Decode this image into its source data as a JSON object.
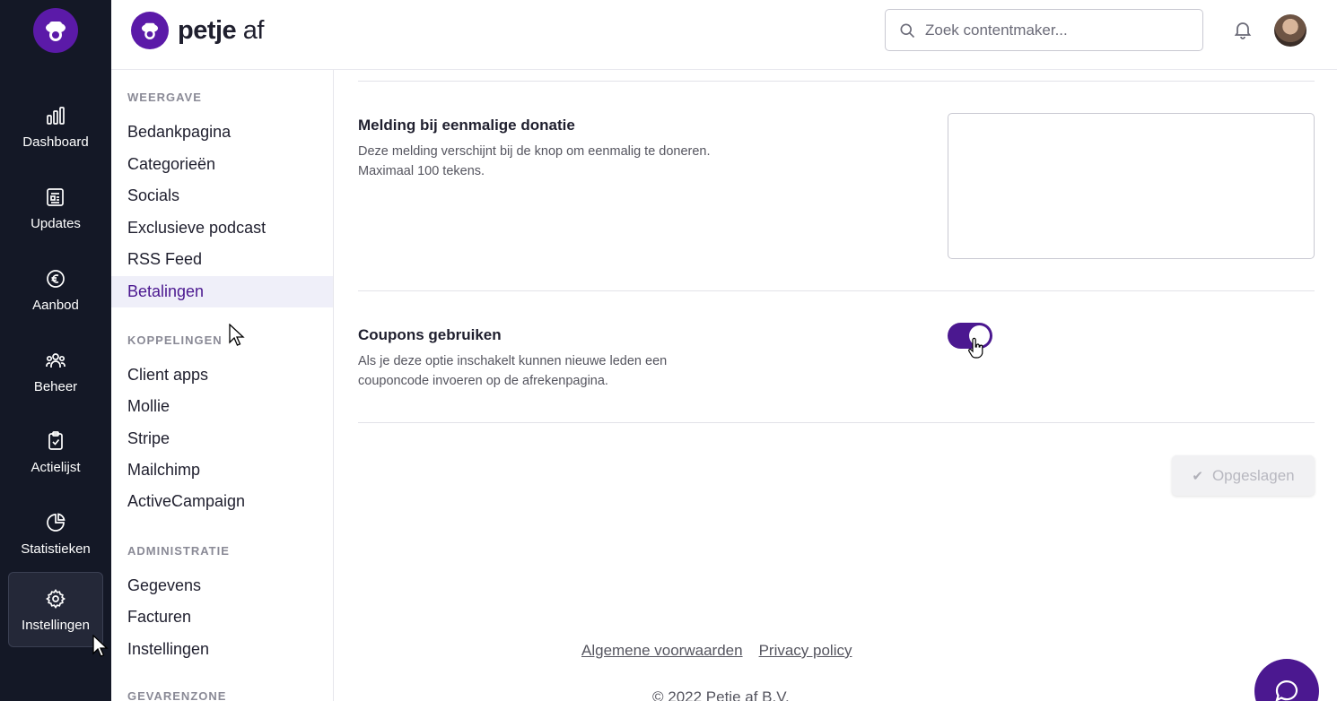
{
  "brand": {
    "name_bold": "petje",
    "name_thin": " af"
  },
  "header": {
    "search": {
      "placeholder": "Zoek contentmaker..."
    },
    "icons": {
      "notifications": "bell-icon",
      "profile": "avatar"
    }
  },
  "rail": {
    "items": [
      {
        "label": "Dashboard",
        "icon": "bar-chart-icon"
      },
      {
        "label": "Updates",
        "icon": "newspaper-icon"
      },
      {
        "label": "Aanbod",
        "icon": "euro-icon"
      },
      {
        "label": "Beheer",
        "icon": "users-icon"
      },
      {
        "label": "Actielijst",
        "icon": "clipboard-check-icon"
      },
      {
        "label": "Statistieken",
        "icon": "pie-chart-icon"
      },
      {
        "label": "Instellingen",
        "icon": "gear-icon",
        "active": true
      }
    ]
  },
  "subnav": {
    "sections": [
      {
        "title": "WEERGAVE",
        "items": [
          "Bedankpagina",
          "Categorieën",
          "Socials",
          "Exclusieve podcast",
          "RSS Feed",
          "Betalingen"
        ]
      },
      {
        "title": "KOPPELINGEN",
        "items": [
          "Client apps",
          "Mollie",
          "Stripe",
          "Mailchimp",
          "ActiveCampaign"
        ]
      },
      {
        "title": "ADMINISTRATIE",
        "items": [
          "Gegevens",
          "Facturen",
          "Instellingen"
        ]
      },
      {
        "title": "GEVARENZONE",
        "items": []
      }
    ],
    "active_item": "Betalingen"
  },
  "main": {
    "donation_notice": {
      "title": "Melding bij eenmalige donatie",
      "desc_line1": "Deze melding verschijnt bij de knop om eenmalig te doneren.",
      "desc_line2": "Maximaal 100 tekens.",
      "value": ""
    },
    "coupons": {
      "title": "Coupons gebruiken",
      "desc_line1": "Als je deze optie inschakelt kunnen nieuwe leden een",
      "desc_line2": "couponcode invoeren op de afrekenpagina.",
      "enabled": true
    },
    "save_button": {
      "label": "Opgeslagen",
      "state": "disabled"
    }
  },
  "footer": {
    "terms": "Algemene voorwaarden",
    "privacy": "Privacy policy",
    "copyright": "© 2022 Petje af B.V."
  },
  "colors": {
    "rail_bg": "#141826",
    "brand_purple": "#4b1890",
    "logo_purple": "#5b1aa8",
    "active_nav_bg": "#efeff9"
  }
}
